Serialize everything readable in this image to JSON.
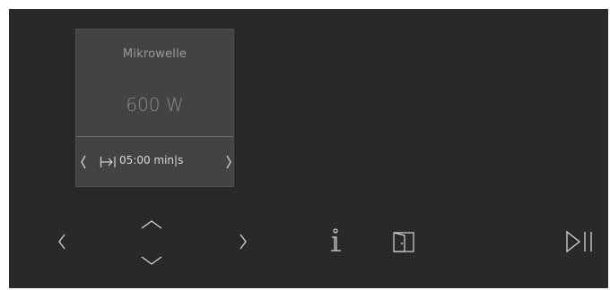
{
  "card": {
    "mode": "Mikrowelle",
    "power": "600 W",
    "duration": "05:00 min|s"
  },
  "icons": {
    "card_prev": "chevron-left-icon",
    "card_next": "chevron-right-icon",
    "duration": "duration-arrow-icon",
    "nav_left": "chevron-left-icon",
    "up": "chevron-up-icon",
    "down": "chevron-down-icon",
    "nav_right": "chevron-right-icon",
    "info": "info-icon",
    "door": "door-icon",
    "play_pause": "play-pause-icon"
  },
  "colors": {
    "background": "#292929",
    "card": "#434343",
    "text_primary": "#d9d9d9",
    "text_muted": "#9a9a9a"
  }
}
